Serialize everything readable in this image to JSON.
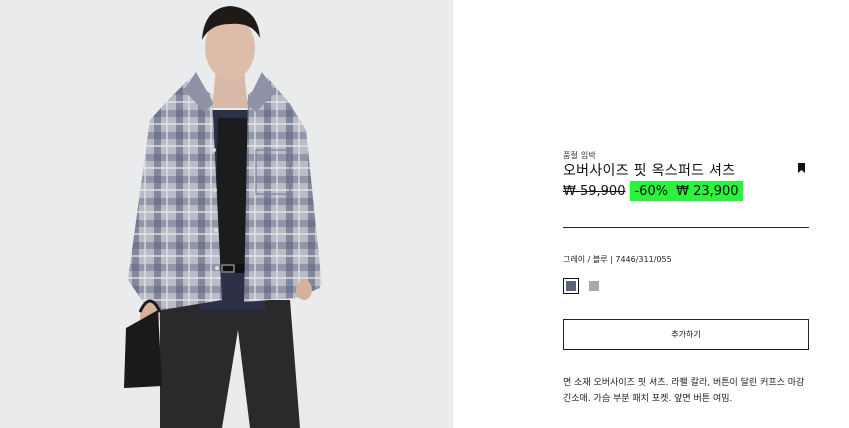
{
  "product": {
    "stock_status": "품절 임박",
    "title": "오버사이즈 핏 옥스퍼드 셔츠",
    "old_price": "₩ 59,900",
    "discount": "-60%",
    "new_price": "₩ 23,900",
    "color_label": "그레이 / 블루",
    "reference": "| 7446/311/055",
    "swatches": [
      {
        "name": "그레이 / 블루",
        "color": "#5d6478",
        "selected": true
      },
      {
        "name": "gray",
        "color": "#a9a9a9",
        "selected": false
      }
    ],
    "add_button_label": "추가하기",
    "description": "면 소재 오버사이즈 핏 셔츠. 라펠 칼라, 버튼이 달린 커프스 마감 긴소매. 가슴 부분 패치 포켓. 앞면 버튼 여밈."
  },
  "colors": {
    "discount_highlight": "#2bf23a",
    "photo_background": "#e9ebec"
  },
  "icons": {
    "bookmark": "bookmark-icon"
  }
}
